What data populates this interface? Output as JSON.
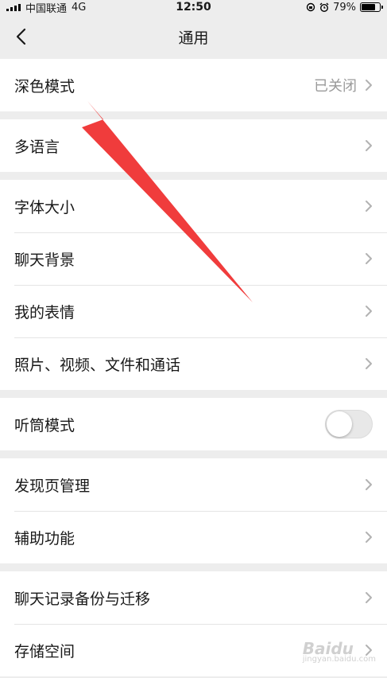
{
  "status_bar": {
    "carrier": "中国联通",
    "network": "4G",
    "time": "12:50",
    "battery": "79%",
    "battery_level": 0.79
  },
  "nav": {
    "title": "通用",
    "back_icon": "chevron-left-icon"
  },
  "groups": [
    {
      "items": [
        {
          "label": "深色模式",
          "value": "已关闭"
        }
      ]
    },
    {
      "items": [
        {
          "label": "多语言"
        }
      ]
    },
    {
      "items": [
        {
          "label": "字体大小"
        },
        {
          "label": "聊天背景"
        },
        {
          "label": "我的表情"
        },
        {
          "label": "照片、视频、文件和通话"
        }
      ]
    },
    {
      "items": [
        {
          "label": "听筒模式",
          "toggle": false
        }
      ]
    },
    {
      "items": [
        {
          "label": "发现页管理"
        },
        {
          "label": "辅助功能"
        }
      ]
    },
    {
      "items": [
        {
          "label": "聊天记录备份与迁移"
        },
        {
          "label": "存储空间"
        }
      ]
    }
  ],
  "annotation_color": "#f03c3c",
  "watermark": {
    "text": "Baidu",
    "sub": "jingyan.baidu.com"
  }
}
